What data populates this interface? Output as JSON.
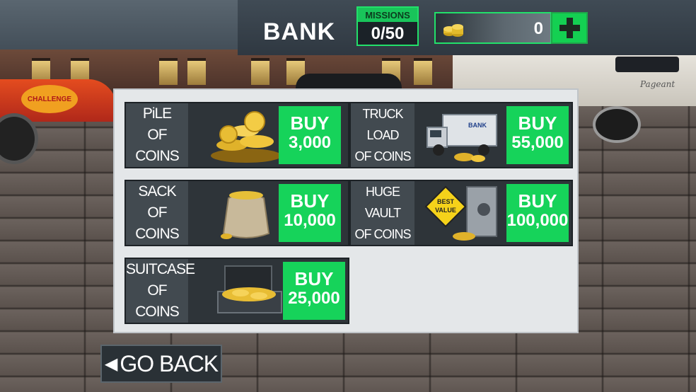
{
  "header": {
    "title": "BANK",
    "missions_label": "MISSIONS",
    "missions_value": "0/50",
    "coin_balance": "0",
    "add_coins_icon": "plus-icon",
    "coin_icon": "coin-stack-icon"
  },
  "scene": {
    "car_decal_text": "CHALLENGE",
    "trailer_text": "Pageant"
  },
  "offers": [
    {
      "label_line1": "PiLE",
      "label_line2": "OF COINS",
      "buy": "BUY",
      "price": "3,000",
      "image": "coin-pile-icon"
    },
    {
      "label_line1": "TRUCK LOAD",
      "label_line2": "OF COINS",
      "buy": "BUY",
      "price": "55,000",
      "image": "armored-truck-icon"
    },
    {
      "label_line1": "SACK",
      "label_line2": "OF COINS",
      "buy": "BUY",
      "price": "10,000",
      "image": "coin-sack-icon"
    },
    {
      "label_line1": "HUGE VAULT",
      "label_line2": "OF COINS",
      "buy": "BUY",
      "price": "100,000",
      "image": "vault-icon",
      "badge_line1": "BEST",
      "badge_line2": "VALUE"
    },
    {
      "label_line1": "SUITCASE",
      "label_line2": "OF COINS",
      "buy": "BUY",
      "price": "25,000",
      "image": "suitcase-icon"
    }
  ],
  "truck_text": "BANK",
  "footer": {
    "back_label": "GO BACK",
    "back_icon": "arrow-left-icon"
  },
  "colors": {
    "accent_green": "#16d35a",
    "panel": "#e4e7e9",
    "card": "#2e3439"
  }
}
